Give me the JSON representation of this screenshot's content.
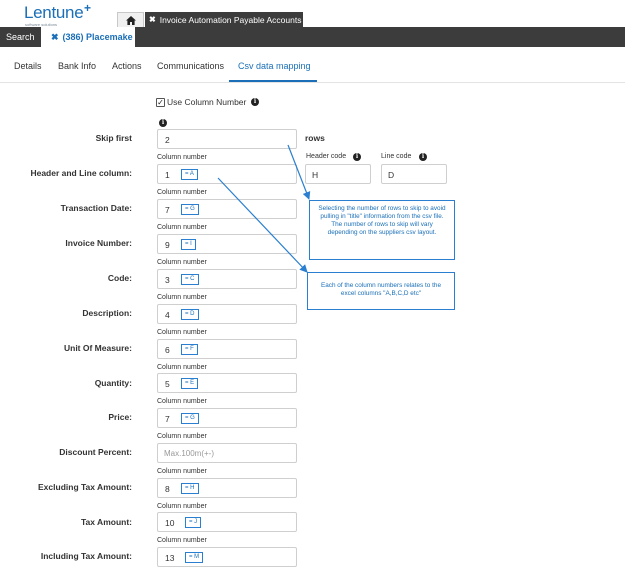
{
  "app": {
    "brand": "Lentune",
    "brand_sub": "software solutions"
  },
  "doc_tab": {
    "label": "Invoice Automation Payable Accounts"
  },
  "nav": {
    "search_label": "Search",
    "record_tab": "(386) Placemake"
  },
  "subtabs": [
    {
      "label": "Details"
    },
    {
      "label": "Bank Info"
    },
    {
      "label": "Actions"
    },
    {
      "label": "Communications"
    },
    {
      "label": "Csv data mapping",
      "active": true
    }
  ],
  "form": {
    "use_column_number_label": "Use Column Number",
    "use_column_number_checked": true,
    "column_caption": "Column number",
    "skip_first": {
      "label": "Skip first",
      "value": "2",
      "suffix": "rows"
    },
    "header_code": {
      "label": "Header code",
      "value": "H"
    },
    "line_code": {
      "label": "Line code",
      "value": "D"
    },
    "rows": [
      {
        "label": "Header and Line column:",
        "value": "1",
        "badge": "= A"
      },
      {
        "label": "Transaction Date:",
        "value": "7",
        "badge": "= G"
      },
      {
        "label": "Invoice Number:",
        "value": "9",
        "badge": "= I"
      },
      {
        "label": "Code:",
        "value": "3",
        "badge": "= C"
      },
      {
        "label": "Description:",
        "value": "4",
        "badge": "= D"
      },
      {
        "label": "Unit Of Measure:",
        "value": "6",
        "badge": "= F"
      },
      {
        "label": "Quantity:",
        "value": "5",
        "badge": "= E"
      },
      {
        "label": "Price:",
        "value": "7",
        "badge": "= G"
      },
      {
        "label": "Discount Percent:",
        "value": "",
        "placeholder": "Max.100m(+-)"
      },
      {
        "label": "Excluding Tax Amount:",
        "value": "8",
        "badge": "= H"
      },
      {
        "label": "Tax Amount:",
        "value": "10",
        "badge": "= J"
      },
      {
        "label": "Including Tax Amount:",
        "value": "13",
        "badge": "= M"
      }
    ]
  },
  "callouts": {
    "skip_rows": "Selecting the number of rows to skip to avoid pulling in \"title\" information from the csv file. The number of rows to skip will vary depending on the suppliers csv layout.",
    "column_numbers": "Each of the column numbers relates to the excel columns \"A,B,C,D etc\""
  },
  "colors": {
    "accent": "#1a6fb8",
    "dark_bar": "#3c3c3c",
    "callout_border": "#2a7fd1"
  },
  "icons": [
    "home-icon",
    "close-icon",
    "info-icon",
    "checkbox-icon"
  ]
}
